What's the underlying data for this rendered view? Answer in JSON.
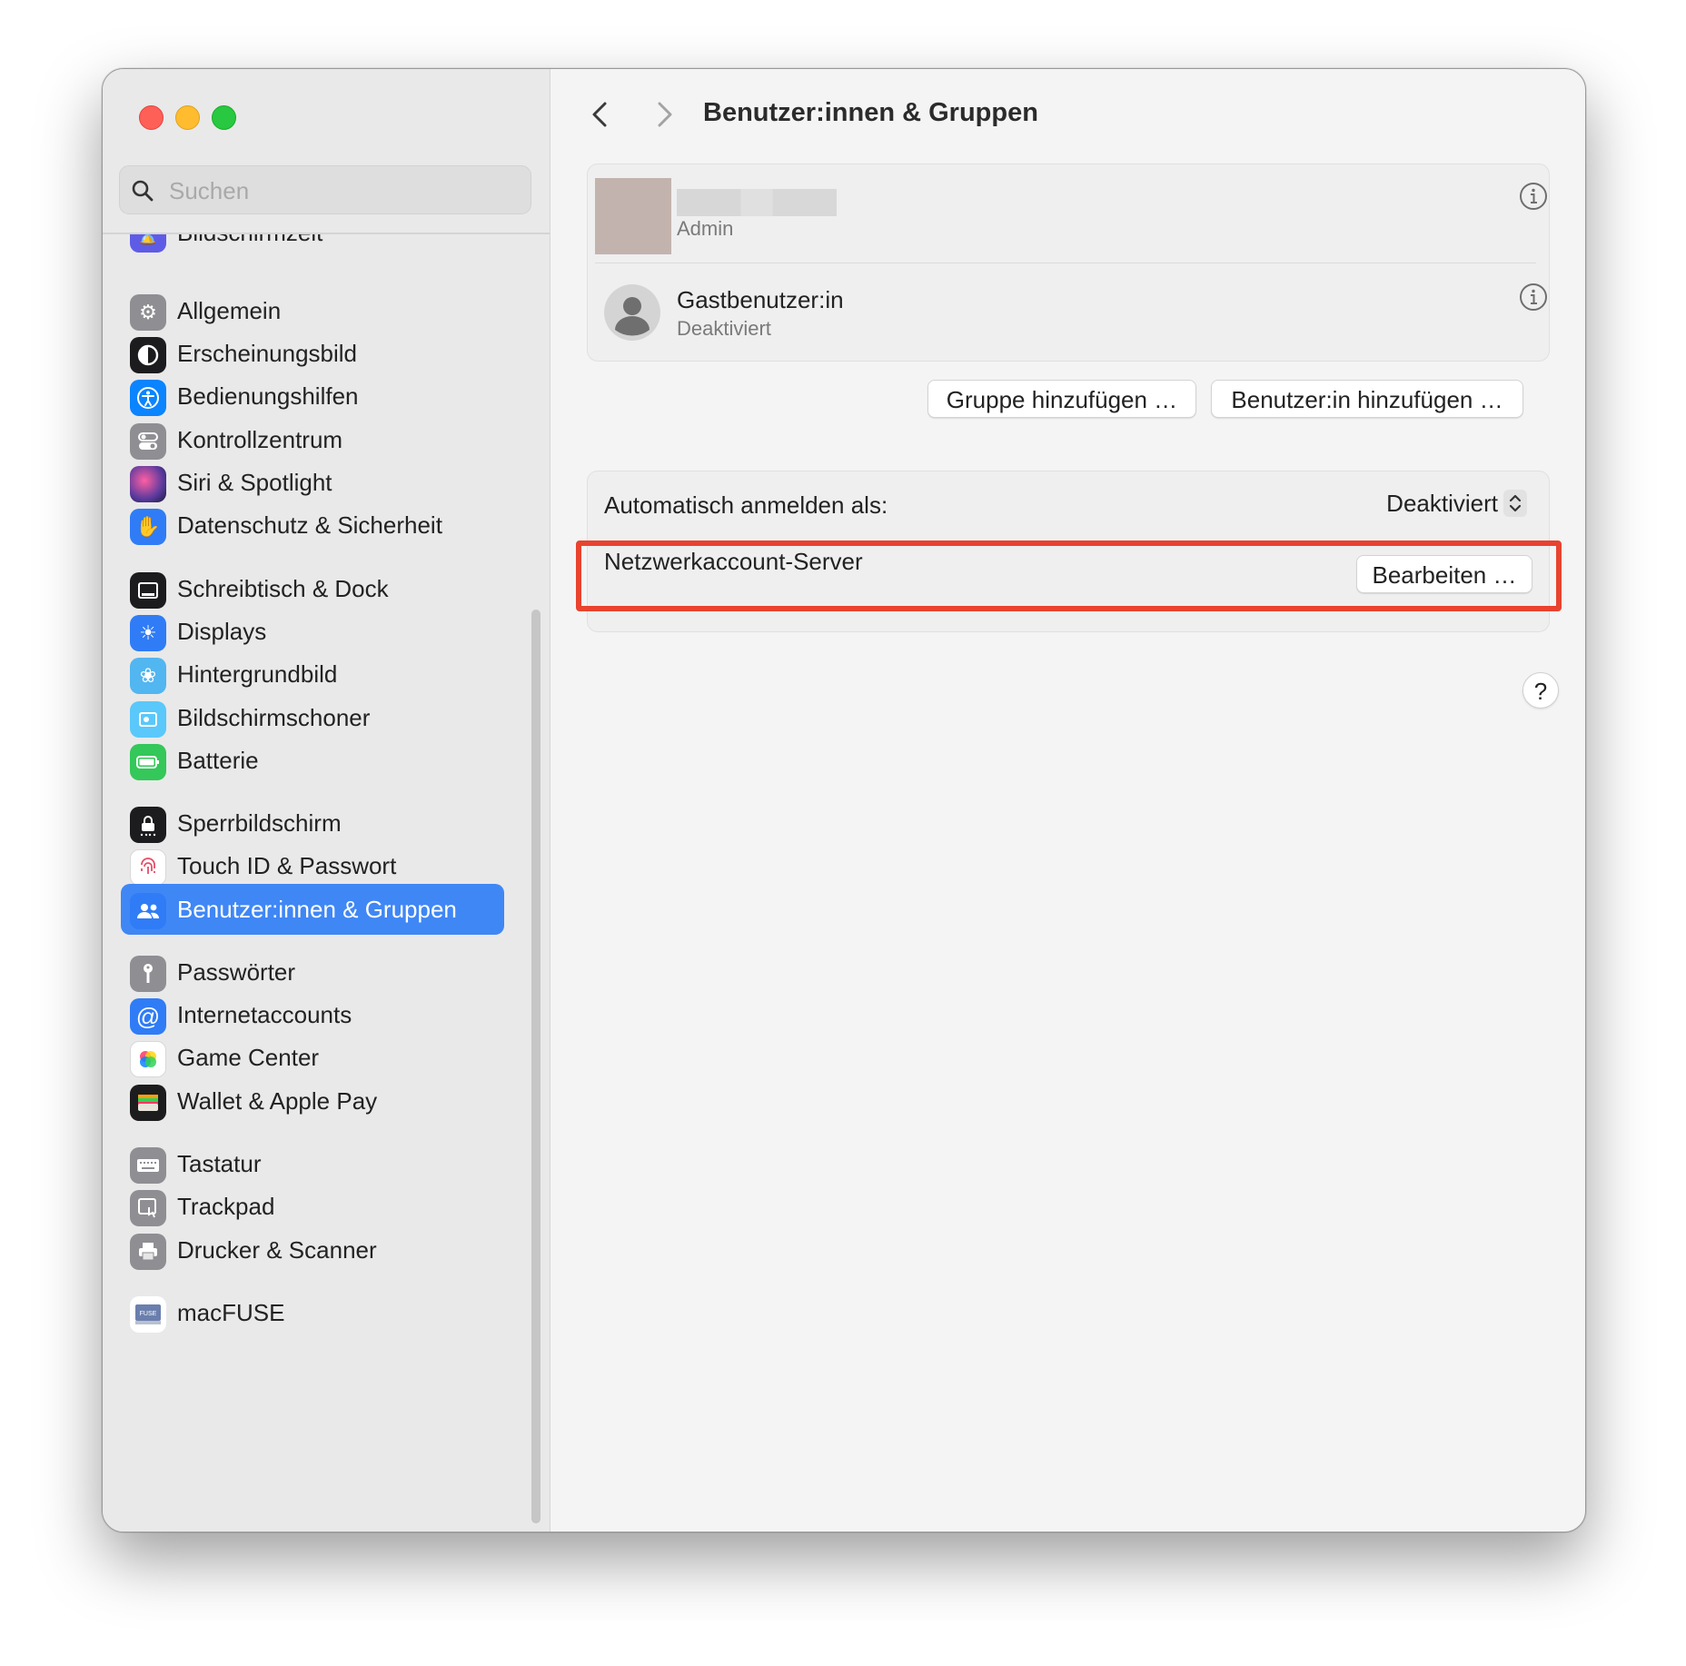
{
  "window": {
    "title": "Benutzer:innen & Gruppen",
    "accent_color": "#3f87f5",
    "highlight_color": "#e8432f"
  },
  "search": {
    "placeholder": "Suchen"
  },
  "sidebar": {
    "partial_item": {
      "label": "Bildschirmzeit",
      "icon": "hourglass-icon",
      "color": "#5e5ce6"
    },
    "items": [
      {
        "label": "Allgemein",
        "icon": "gear-icon",
        "color": "#8e8e93"
      },
      {
        "label": "Erscheinungsbild",
        "icon": "appearance-icon",
        "color": "#1c1c1e"
      },
      {
        "label": "Bedienungshilfen",
        "icon": "accessibility-icon",
        "color": "#0a84ff"
      },
      {
        "label": "Kontrollzentrum",
        "icon": "control-center-icon",
        "color": "#8e8e93"
      },
      {
        "label": "Siri & Spotlight",
        "icon": "siri-icon",
        "color": "#5a3a9e"
      },
      {
        "label": "Datenschutz & Sicherheit",
        "icon": "hand-icon",
        "color": "#2f7cf6"
      },
      {
        "label": "Schreibtisch & Dock",
        "icon": "dock-icon",
        "color": "#1c1c1e"
      },
      {
        "label": "Displays",
        "icon": "sun-icon",
        "color": "#2f7cf6"
      },
      {
        "label": "Hintergrundbild",
        "icon": "flower-icon",
        "color": "#52b6f0"
      },
      {
        "label": "Bildschirmschoner",
        "icon": "screensaver-icon",
        "color": "#5ac8fa"
      },
      {
        "label": "Batterie",
        "icon": "battery-icon",
        "color": "#34c759"
      },
      {
        "label": "Sperrbildschirm",
        "icon": "lock-icon",
        "color": "#1c1c1e"
      },
      {
        "label": "Touch ID & Passwort",
        "icon": "fingerprint-icon",
        "color": "#ffffff"
      },
      {
        "label": "Benutzer:innen & Gruppen",
        "icon": "users-icon",
        "color": "#2f7cf6",
        "selected": true
      },
      {
        "label": "Passwörter",
        "icon": "key-icon",
        "color": "#8e8e93"
      },
      {
        "label": "Internetaccounts",
        "icon": "at-icon",
        "color": "#2f7cf6"
      },
      {
        "label": "Game Center",
        "icon": "game-center-icon",
        "color": "#ffffff"
      },
      {
        "label": "Wallet & Apple Pay",
        "icon": "wallet-icon",
        "color": "#1c1c1e"
      },
      {
        "label": "Tastatur",
        "icon": "keyboard-icon",
        "color": "#8e8e93"
      },
      {
        "label": "Trackpad",
        "icon": "trackpad-icon",
        "color": "#8e8e93"
      },
      {
        "label": "Drucker & Scanner",
        "icon": "printer-icon",
        "color": "#8e8e93"
      },
      {
        "label": "macFUSE",
        "icon": "macfuse-icon",
        "color": "#ffffff"
      }
    ]
  },
  "main": {
    "title": "Benutzer:innen & Gruppen",
    "users": [
      {
        "name": "",
        "role": "Admin",
        "avatar": "photo-avatar"
      },
      {
        "name": "Gastbenutzer:in",
        "role": "Deaktiviert",
        "avatar": "person-avatar-icon"
      }
    ],
    "buttons": {
      "add_group": "Gruppe hinzufügen …",
      "add_user": "Benutzer:in hinzufügen …"
    },
    "auto_login": {
      "label": "Automatisch anmelden als:",
      "value": "Deaktiviert"
    },
    "network_server": {
      "label": "Netzwerkaccount-Server",
      "button": "Bearbeiten …"
    },
    "help": "?"
  }
}
